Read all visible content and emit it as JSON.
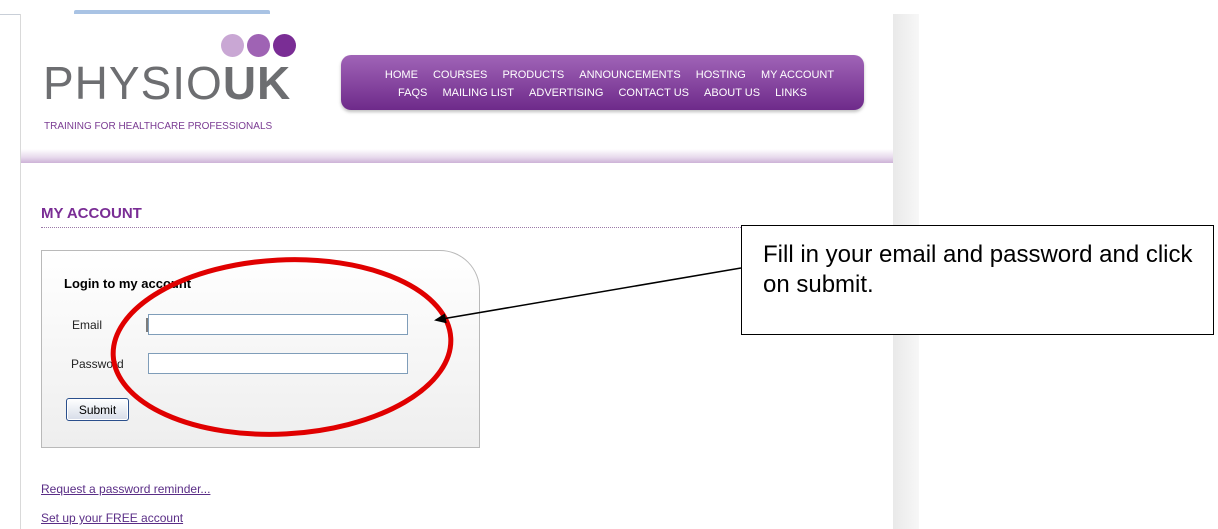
{
  "brand": {
    "name_part1": "PHYSIO",
    "name_part2": "UK",
    "tagline": "TRAINING FOR HEALTHCARE PROFESSIONALS"
  },
  "nav": {
    "row1": [
      "HOME",
      "COURSES",
      "PRODUCTS",
      "ANNOUNCEMENTS",
      "HOSTING",
      "MY ACCOUNT"
    ],
    "row2": [
      "FAQS",
      "MAILING LIST",
      "ADVERTISING",
      "CONTACT US",
      "ABOUT US",
      "LINKS"
    ]
  },
  "page": {
    "title": "MY ACCOUNT"
  },
  "login": {
    "heading": "Login to my account",
    "email_label": "Email",
    "email_value": "",
    "password_label": "Password",
    "password_value": "",
    "submit_label": "Submit"
  },
  "links": {
    "reminder": "Request a password reminder...",
    "free_account": "Set up your FREE account"
  },
  "annotation": {
    "callout_text": "Fill in your email and password and click on submit."
  },
  "colors": {
    "brand_purple": "#7a2d95",
    "nav_top": "#a064b7",
    "nav_bottom": "#6e2a8a",
    "annotation_red": "#e00000"
  },
  "icons": {
    "logo_dots": "three-purple-dots"
  }
}
